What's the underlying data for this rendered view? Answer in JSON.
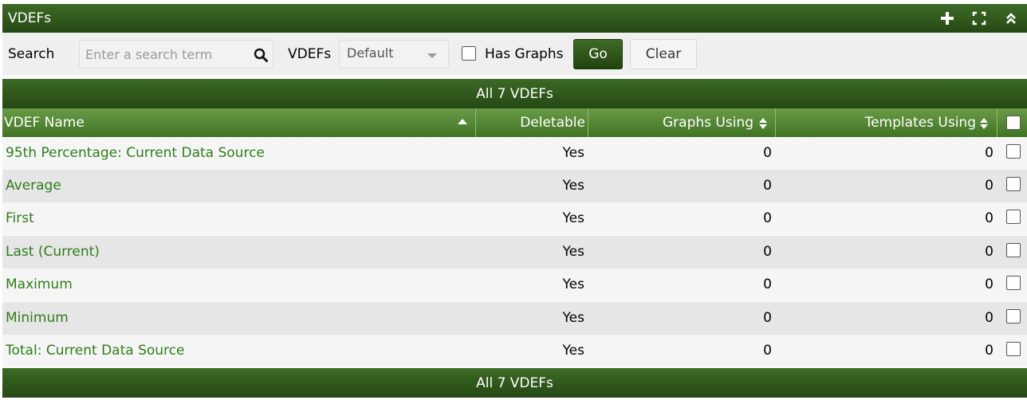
{
  "header": {
    "title": "VDEFs",
    "icons": [
      "plus-icon",
      "fullscreen-icon",
      "collapse-up-icon"
    ]
  },
  "filter": {
    "search_label": "Search",
    "search_placeholder": "Enter a search term",
    "vdefs_label": "VDEFs",
    "vdefs_selected": "Default",
    "has_graphs_label": "Has Graphs",
    "go_label": "Go",
    "clear_label": "Clear"
  },
  "nav": {
    "top_text": "All 7 VDEFs",
    "bottom_text": "All 7 VDEFs"
  },
  "table": {
    "columns": {
      "name": "VDEF Name",
      "deletable": "Deletable",
      "graphs": "Graphs Using",
      "templates": "Templates Using"
    },
    "rows": [
      {
        "name": "95th Percentage: Current Data Source",
        "deletable": "Yes",
        "graphs": "0",
        "templates": "0"
      },
      {
        "name": "Average",
        "deletable": "Yes",
        "graphs": "0",
        "templates": "0"
      },
      {
        "name": "First",
        "deletable": "Yes",
        "graphs": "0",
        "templates": "0"
      },
      {
        "name": "Last (Current)",
        "deletable": "Yes",
        "graphs": "0",
        "templates": "0"
      },
      {
        "name": "Maximum",
        "deletable": "Yes",
        "graphs": "0",
        "templates": "0"
      },
      {
        "name": "Minimum",
        "deletable": "Yes",
        "graphs": "0",
        "templates": "0"
      },
      {
        "name": "Total: Current Data Source",
        "deletable": "Yes",
        "graphs": "0",
        "templates": "0"
      }
    ]
  },
  "colors": {
    "header_green": "#254915",
    "link_green": "#2e7d1a",
    "column_header_green": "#4f8330"
  }
}
